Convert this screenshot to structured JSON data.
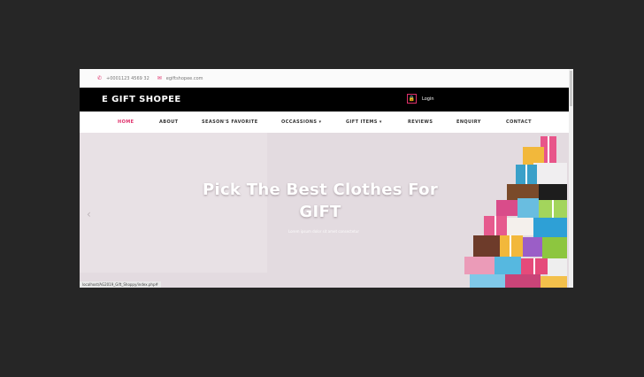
{
  "topbar": {
    "phone": "+0001123 4569 32",
    "email": "egiftshopee.com",
    "phone_icon": "phone-icon",
    "mail_icon": "mail-icon"
  },
  "header": {
    "brand": "E GIFT SHOPEE",
    "login_label": "Login",
    "login_icon": "lock-icon"
  },
  "nav": {
    "items": [
      {
        "label": "HOME"
      },
      {
        "label": "ABOUT"
      },
      {
        "label": "SEASON'S FAVORITE"
      },
      {
        "label": "OCCASSIONS ▾"
      },
      {
        "label": "GIFT ITEMS ▾"
      },
      {
        "label": "REVIEWS"
      },
      {
        "label": "ENQUIRY"
      },
      {
        "label": "CONTACT"
      }
    ],
    "active_color": "#e0306b"
  },
  "hero": {
    "headline_line1": "Pick The Best Clothes For",
    "headline_line2": "GIFT",
    "subtitle": "Lorem ipsum dolor sit amet consectetur",
    "prev_icon": "chevron-left-icon"
  },
  "status": {
    "url": "localhost/AG2019_Gift_Shoppy/index.php#"
  },
  "colors": {
    "accent": "#e0306b",
    "header_bg": "#000000"
  }
}
